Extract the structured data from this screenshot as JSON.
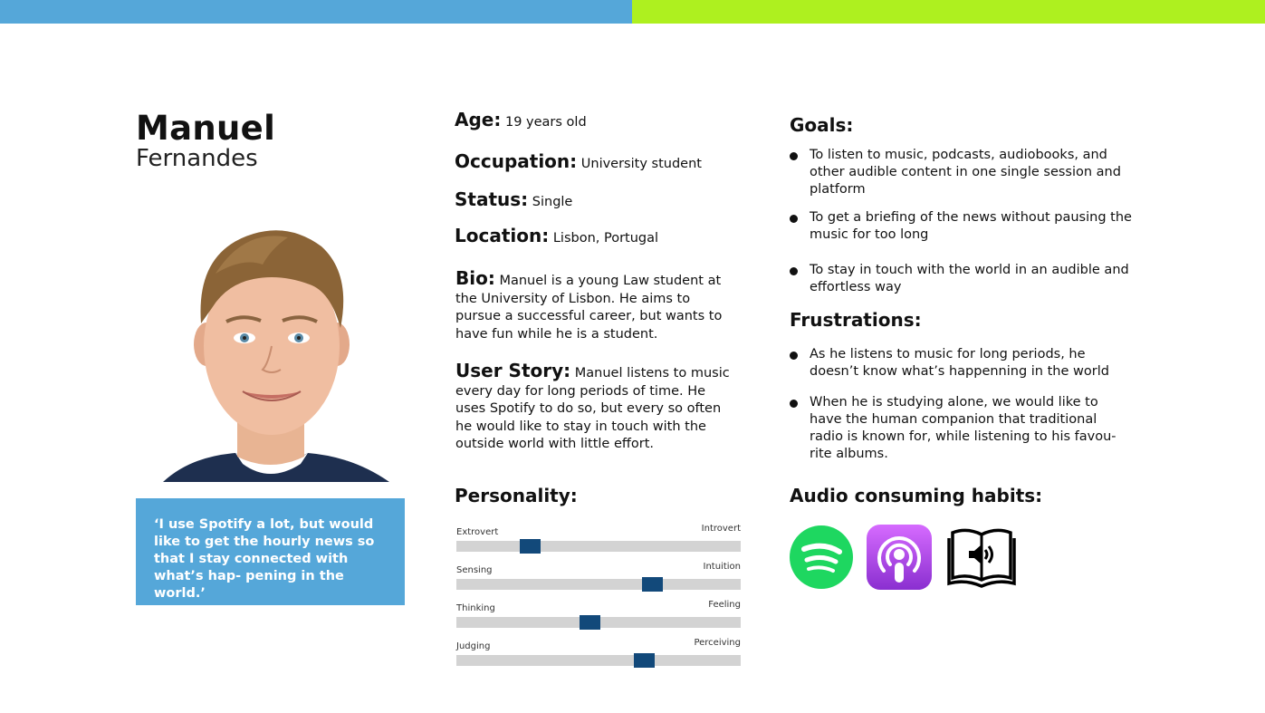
{
  "persona": {
    "first_name": "Manuel",
    "last_name": "Fernandes",
    "quote_mark": "‘",
    "quote": "I use Spotify a lot, but would like to get the hourly news so that I stay connected with what’s hap- pening in the world.’"
  },
  "details": {
    "age_label": "Age:",
    "age_value": "19  years old",
    "occupation_label": "Occupation:",
    "occupation_value": "University student",
    "status_label": "Status:",
    "status_value": "Single",
    "location_label": "Location:",
    "location_value": "Lisbon, Portugal",
    "bio_label": "Bio:",
    "bio_text": "Manuel is a young Law student at the University of Lisbon. He aims to pursue a successful career, but wants to have fun while he is a student.",
    "story_label": "User Story:",
    "story_text": "Manuel listens to music every day for long periods of time. He uses Spotify to do so, but every so often he would like to stay in touch with the outside world with little effort."
  },
  "personality": {
    "title": "Personality:",
    "traits": [
      {
        "left": "Extrovert",
        "right": "Introvert",
        "value": 0.26
      },
      {
        "left": "Sensing",
        "right": "Intuition",
        "value": 0.69
      },
      {
        "left": "Thinking",
        "right": "Feeling",
        "value": 0.47
      },
      {
        "left": "Judging",
        "right": "Perceiving",
        "value": 0.66
      }
    ]
  },
  "goals": {
    "title": "Goals:",
    "items": [
      "To listen to music, podcasts, audiobooks, and other audible content in one single session and platform",
      "To get a briefing of the news without pausing the music for too long",
      "To stay in touch with the world in an audible and effortless way"
    ]
  },
  "frustrations": {
    "title": "Frustrations:",
    "items": [
      "As he listens to music for long periods, he doesn’t know what’s happenning in the world",
      "When he is studying alone, we would like to have the human companion that traditional radio is known for, while listening to his favou- rite albums."
    ]
  },
  "habits": {
    "title": "Audio consuming habits:",
    "icons": [
      "spotify-icon",
      "podcasts-icon",
      "audiobook-icon"
    ]
  },
  "colors": {
    "top_bar_left": "#55a7d9",
    "top_bar_right": "#aef01f",
    "quote_bg": "#55a7d9",
    "slider_knob": "#12497a",
    "slider_track": "#d3d3d3",
    "spotify_green": "#1ed760",
    "podcasts_purple": "#9b3ad9"
  }
}
